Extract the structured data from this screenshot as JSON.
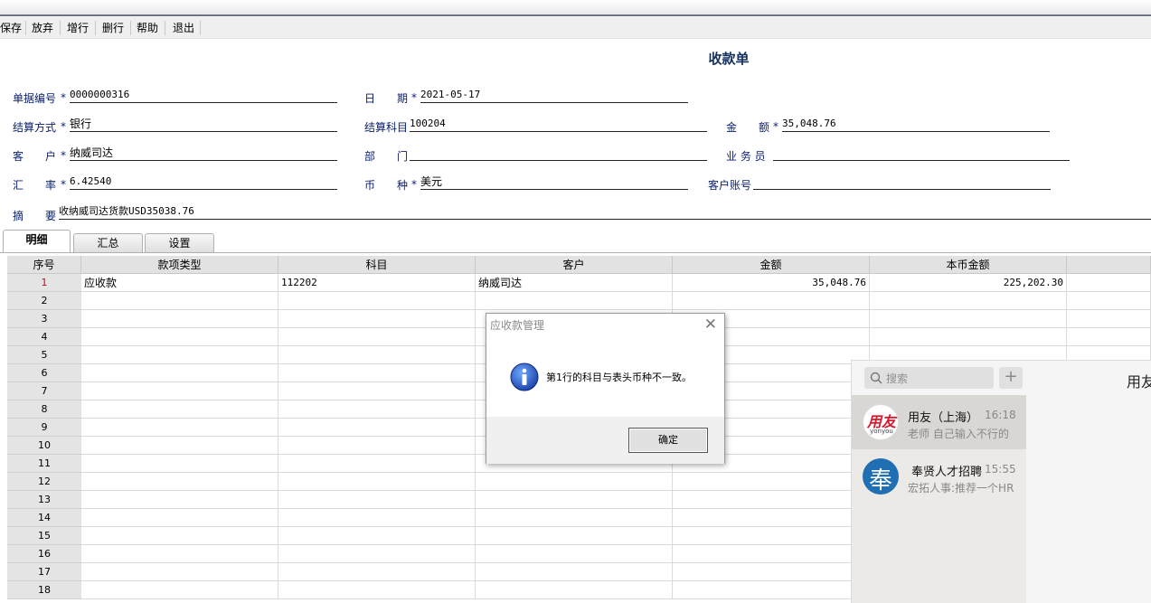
{
  "toolbar": {
    "save": "保存",
    "discard": "放弃",
    "add_row": "增行",
    "delete_row": "删行",
    "help": "帮助",
    "exit": "退出"
  },
  "form": {
    "title": "收款单",
    "doc_no_label": "单据编号",
    "doc_no": "0000000316",
    "date_label_1": "日",
    "date_label_2": "期",
    "date": "2021-05-17",
    "settle_method_label": "结算方式",
    "settle_method": "银行",
    "settle_account_label": "结算科目",
    "settle_account": "100204",
    "amount_label_1": "金",
    "amount_label_2": "额",
    "amount": "35,048.76",
    "customer_label_1": "客",
    "customer_label_2": "户",
    "customer": "纳威司达",
    "dept_label_1": "部",
    "dept_label_2": "门",
    "dept": "",
    "salesman_label": "业 务 员",
    "salesman": "",
    "rate_label_1": "汇",
    "rate_label_2": "率",
    "rate": "6.42540",
    "currency_label_1": "币",
    "currency_label_2": "种",
    "currency": "美元",
    "cust_account_label": "客户账号",
    "cust_account": "",
    "memo_label_1": "摘",
    "memo_label_2": "要",
    "memo": "收纳威司达货款USD35038.76",
    "required_mark": "*"
  },
  "tabs": [
    "明细",
    "汇总",
    "设置"
  ],
  "grid": {
    "headers": [
      "序号",
      "款项类型",
      "科目",
      "客户",
      "金额",
      "本币金额"
    ],
    "rows": [
      {
        "no": "1",
        "type": "应收款",
        "account": "112202",
        "customer": "纳威司达",
        "amount": "35,048.76",
        "local_amount": "225,202.30"
      },
      {
        "no": "2"
      },
      {
        "no": "3"
      },
      {
        "no": "4"
      },
      {
        "no": "5"
      },
      {
        "no": "6"
      },
      {
        "no": "7"
      },
      {
        "no": "8"
      },
      {
        "no": "9"
      },
      {
        "no": "10"
      },
      {
        "no": "11"
      },
      {
        "no": "12"
      },
      {
        "no": "13"
      },
      {
        "no": "14"
      },
      {
        "no": "15"
      },
      {
        "no": "16"
      },
      {
        "no": "17"
      },
      {
        "no": "18"
      }
    ]
  },
  "dialog": {
    "title": "应收款管理",
    "message": "第1行的科目与表头币种不一致。",
    "ok": "确定"
  },
  "chat": {
    "search_placeholder": "搜索",
    "window_title": "用友",
    "items": [
      {
        "name": "用友（上海）",
        "time": "16:18",
        "preview": "老师 自己输入不行的",
        "avatar_text": "用友",
        "avatar_sub": "yonyou"
      },
      {
        "name": "奉贤人才招聘",
        "time": "15:55",
        "preview": "宏拓人事:推荐一个HR",
        "avatar_text": "奉"
      }
    ]
  },
  "colors": {
    "label_blue": "#0a1f6e",
    "title_blue": "#13305d",
    "row_one_red": "#d0021b",
    "yonyou_red": "#d7192d",
    "fengxian_blue": "#1f6fb2"
  }
}
